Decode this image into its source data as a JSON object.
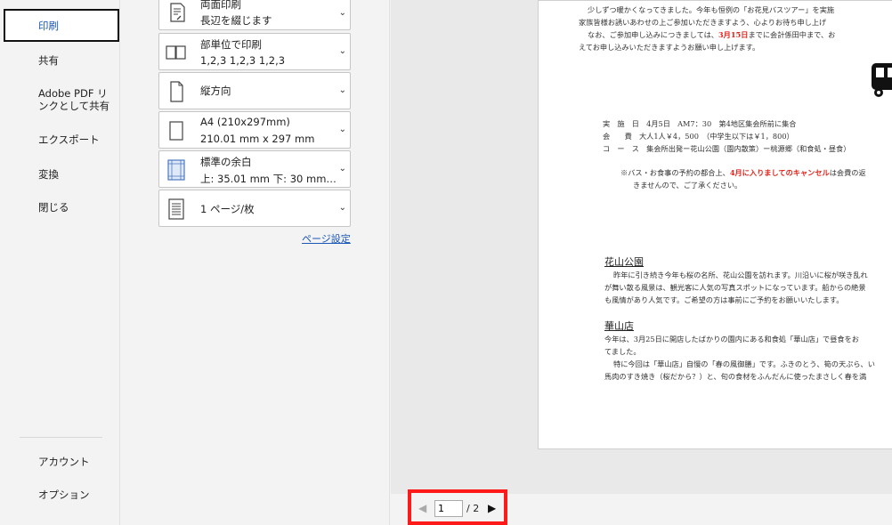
{
  "nav": {
    "items": [
      {
        "label": "印刷"
      },
      {
        "label": "共有"
      },
      {
        "label": "Adobe PDF リ"
      },
      {
        "label": "ンクとして共有"
      },
      {
        "label": "エクスポート"
      },
      {
        "label": "変換"
      },
      {
        "label": "閉じる"
      },
      {
        "label": "アカウント"
      },
      {
        "label": "オプション"
      }
    ]
  },
  "settings": {
    "duplex": {
      "title": "両面印刷",
      "sub": "長辺を綴じます"
    },
    "collate": {
      "title": "部単位で印刷",
      "sub": "1,2,3    1,2,3    1,2,3"
    },
    "orientation": {
      "title": "縦方向"
    },
    "paper": {
      "title": "A4 (210x297mm)",
      "sub": "210.01 mm x 297 mm"
    },
    "margins": {
      "title": "標準の余白",
      "sub": "上: 35.01 mm 下: 30 mm…"
    },
    "pages_per_sheet": {
      "title": "1 ページ/枚"
    },
    "page_setup_link": "ページ設定"
  },
  "preview": {
    "lines": [
      "少しずつ暖かくなってきました。今年も恒例の「お花見バスツアー」を実施",
      "家族皆様お誘いあわせの上ご参加いただきますよう、心よりお待ち申し上げ",
      "なお、ご参加申し込みにつきましては、",
      "3月15日",
      "までに会計係田中まで、お",
      "えてお申し込みいただきますようお願い申し上げます。",
      "実　施　日　4月5日　AM7：30　第4地区集会所前に集合",
      "会　　費　大人1人￥4，500　（中学生以下は￥1，800）",
      "コ　ー　ス　集会所出発ー花山公園（園内散策）ー桃源郷（和食処・昼食）",
      "※バス・お食事の予約の都合上、",
      "4月に入りましてのキャンセル",
      "は会費の返",
      "きませんので、ご了承ください。",
      "花山公園",
      "昨年に引き続き今年も桜の名所、花山公園を訪れます。川沿いに桜が咲き乱れ",
      "が舞い散る風景は、観光客に人気の写真スポットになっています。船からの絶景",
      "も風情があり人気です。ご希望の方は事前にご予約をお願いいたします。",
      "華山店",
      "今年は、3月25日に開店したばかりの園内にある和食処「華山店」で昼食をお",
      "てました。",
      "特に今回は「華山店」自慢の「春の風御膳」です。ふきのとう、筍の天ぷら、い",
      "馬肉のすき焼き（桜だから？）と、旬の食材をふんだんに使ったまさしく春を満"
    ]
  },
  "pager": {
    "current": "1",
    "total": "/ 2"
  }
}
